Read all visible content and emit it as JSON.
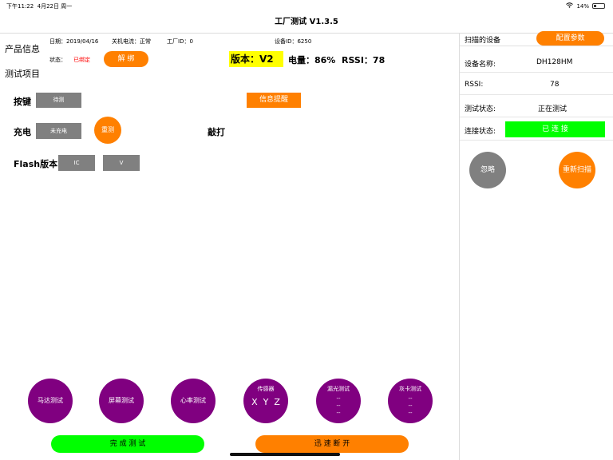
{
  "status_bar": {
    "time": "下午11:22",
    "date": "4月22日 周一",
    "battery": "14%"
  },
  "nav": {
    "title": "工厂测试 V1.3.5"
  },
  "product": {
    "section_title": "产品信息",
    "date": "日期：2019/04/16",
    "shutdown_current": "关机电流：正常",
    "factory_id": "工厂ID：0",
    "device_id": "设备ID：6250",
    "status_label": "状态：",
    "status_value": "已绑定",
    "unbind_label": "解 绑",
    "version": "版本：V2",
    "battery": "电量：86%",
    "rssi": "RSSI：78"
  },
  "tests": {
    "section_title": "测试项目",
    "key_label": "按键",
    "key_status": "待测",
    "info_reminder": "信息提醒",
    "charge_label": "充电",
    "charge_status": "未充电",
    "retest": "重测",
    "tap_label": "敲打",
    "flash_label": "Flash版本",
    "flash_ic": "IC",
    "flash_v": "V"
  },
  "circles": {
    "motor": "马达测试",
    "screen": "屏幕测试",
    "heart": "心率测试",
    "sensor_title": "传感器",
    "sensor_xyz": "X  Y  Z",
    "light_title": "漏光测试",
    "light_line1": "--",
    "light_line2": "--",
    "light_line3": "--",
    "gray_title": "灰卡测试",
    "gray_line1": "--",
    "gray_line2": "--",
    "gray_line3": "--"
  },
  "bottom": {
    "complete": "完 成 测 试",
    "disconnect": "迅 速 断 开"
  },
  "side": {
    "scan_title": "扫描的设备",
    "config": "配置参数",
    "name_label": "设备名称:",
    "name_value": "DH128HM",
    "rssi_label": "RSSI:",
    "rssi_value": "78",
    "test_label": "测试状态:",
    "test_value": "正在测试",
    "conn_label": "连接状态:",
    "conn_value": "已 连 接",
    "ignore": "忽略",
    "rescan": "重新扫描"
  },
  "colors": {
    "orange": "#ff8000",
    "purple": "#800080",
    "green": "#00ff00",
    "yellow": "#ffff00",
    "gray": "#808080",
    "red": "#ff0000"
  }
}
